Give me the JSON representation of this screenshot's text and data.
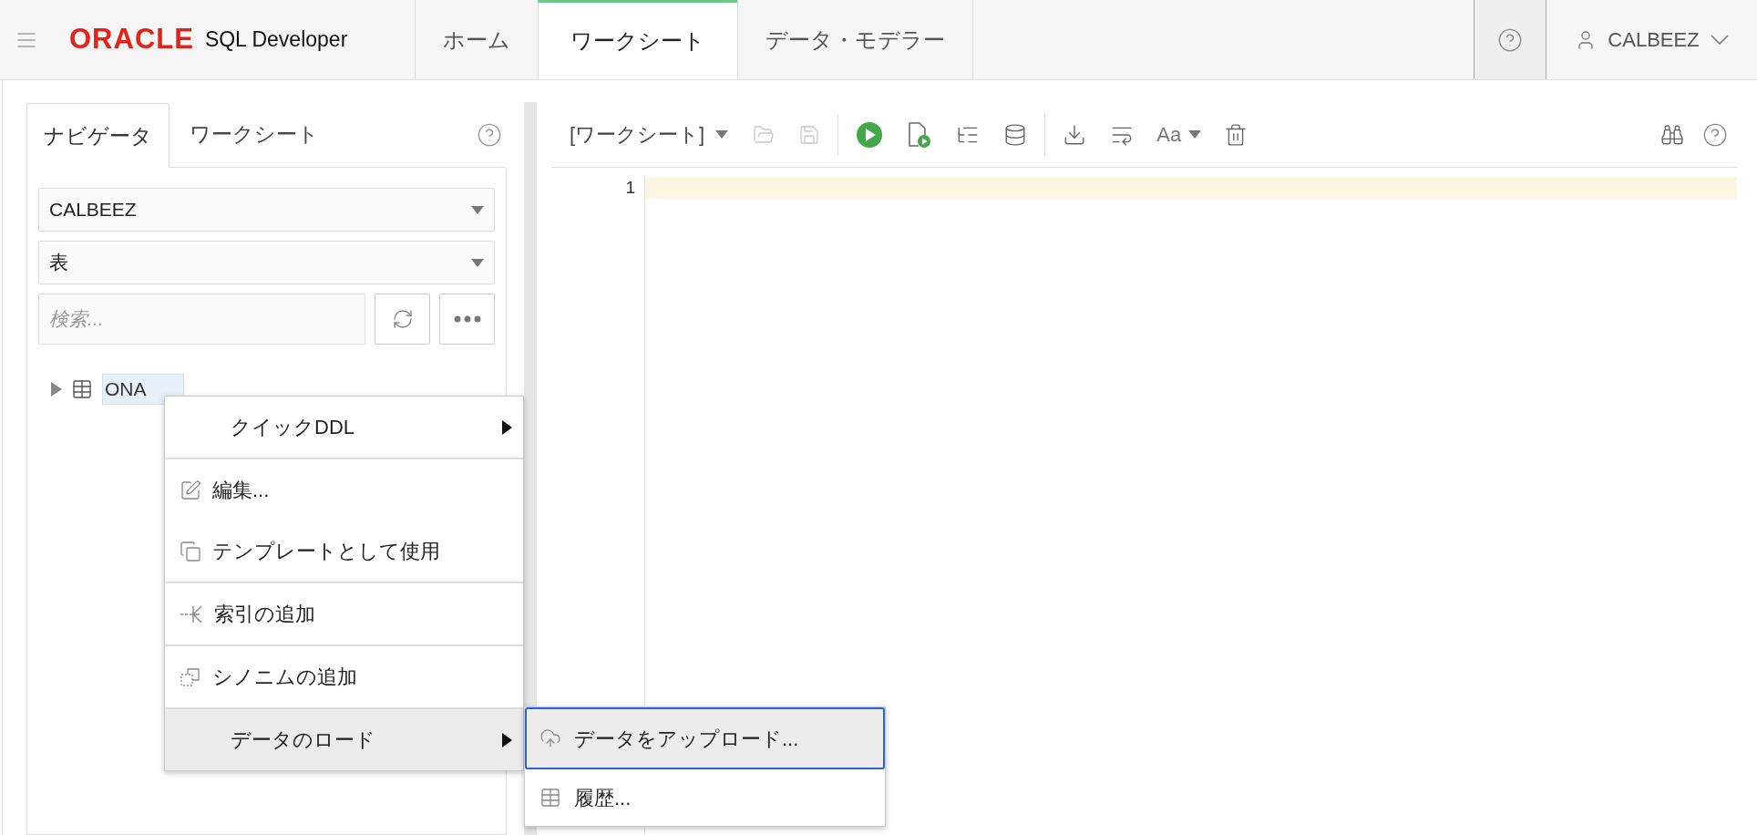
{
  "header": {
    "logo_text": "ORACLE",
    "product": "SQL Developer",
    "user": "CALBEEZ"
  },
  "top_tabs": [
    {
      "label": "ホーム",
      "selected": false
    },
    {
      "label": "ワークシート",
      "selected": true
    },
    {
      "label": "データ・モデラー",
      "selected": false
    }
  ],
  "navigator": {
    "tabs": [
      {
        "label": "ナビゲータ",
        "selected": true
      },
      {
        "label": "ワークシート",
        "selected": false
      }
    ],
    "schema_select": "CALBEEZ",
    "type_select": "表",
    "search": {
      "placeholder": "検索..."
    },
    "tree": [
      {
        "label": "ONA",
        "selected": true,
        "expanded": false
      }
    ]
  },
  "editor": {
    "worksheet_menu": "[ワークシート]",
    "font_menu": "Aa",
    "toolbar": [
      {
        "kind": "open",
        "disabled": true
      },
      {
        "kind": "save",
        "disabled": true
      },
      {
        "kind": "separator",
        "disabled": false
      },
      {
        "kind": "run",
        "disabled": false
      },
      {
        "kind": "script",
        "disabled": false
      },
      {
        "kind": "plan",
        "disabled": false
      },
      {
        "kind": "autotrace",
        "disabled": false
      },
      {
        "kind": "separator",
        "disabled": false
      },
      {
        "kind": "download",
        "disabled": false
      },
      {
        "kind": "format",
        "disabled": false
      },
      {
        "kind": "font",
        "disabled": false
      },
      {
        "kind": "delete",
        "disabled": false
      }
    ],
    "line_numbers": [
      "1"
    ]
  },
  "context_menu": {
    "groups": [
      [
        {
          "kind": "submenu",
          "label": "クイックDDL",
          "selected": false
        }
      ],
      [
        {
          "kind": "edit",
          "label": "編集...",
          "selected": false
        },
        {
          "kind": "copy",
          "label": "テンプレートとして使用",
          "selected": false
        }
      ],
      [
        {
          "kind": "index",
          "label": "索引の追加",
          "selected": false
        }
      ],
      [
        {
          "kind": "synonym",
          "label": "シノニムの追加",
          "selected": false
        }
      ],
      [
        {
          "kind": "submenu",
          "label": "データのロード",
          "selected": true
        }
      ]
    ],
    "submenu": [
      {
        "kind": "upload",
        "label": "データをアップロード...",
        "selected": true
      },
      {
        "kind": "history",
        "label": "履歴...",
        "selected": false
      }
    ]
  }
}
